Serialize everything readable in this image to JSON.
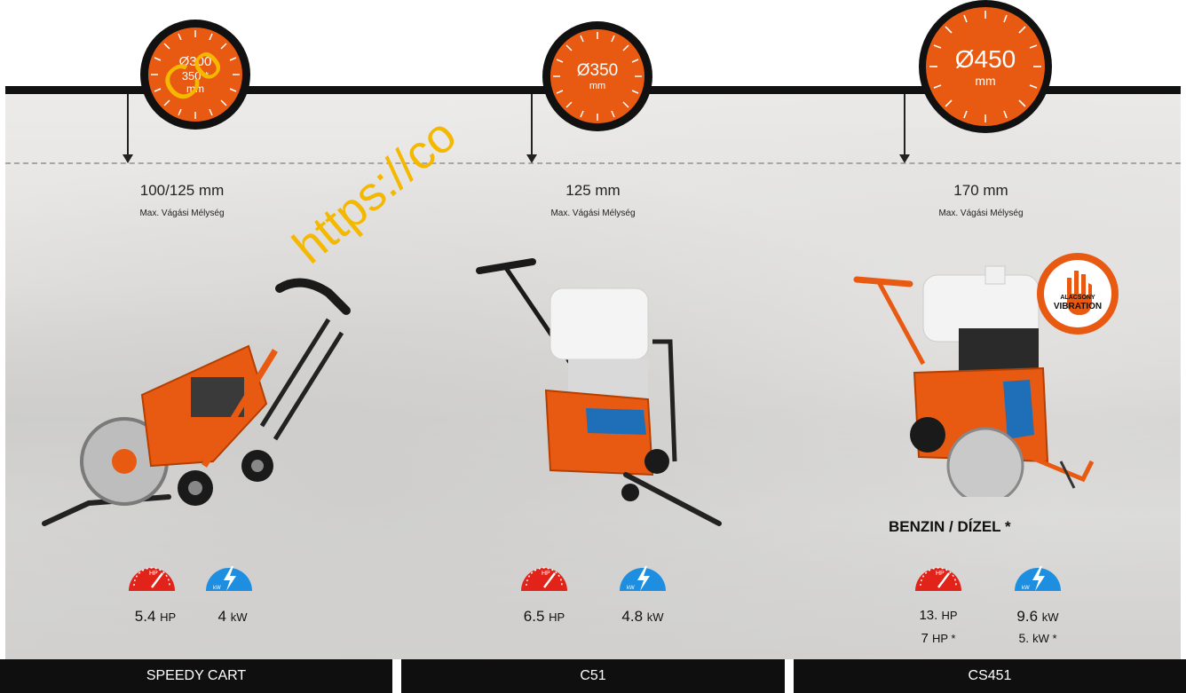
{
  "colors": {
    "accent": "#e85a12",
    "hp_gauge": "#e2231a",
    "kw_gauge": "#1e8fe0",
    "bar": "#111111"
  },
  "watermark": {
    "line1": "Co",
    "line2": "https://co"
  },
  "products": [
    {
      "disc": {
        "size": "Ø300",
        "line2": "350 *",
        "unit": "mm"
      },
      "depth": {
        "value": "100/125 mm",
        "label": "Max. Vágási Mélység"
      },
      "hp": {
        "value": "5.4",
        "unit": "HP",
        "icon": "hp-gauge-icon",
        "icon_label": "HP"
      },
      "kw": {
        "value": "4",
        "unit": "kW",
        "icon": "lightning-icon",
        "icon_label": "kW"
      },
      "name": "SPEEDY CART"
    },
    {
      "disc": {
        "size": "Ø350",
        "unit": "mm"
      },
      "depth": {
        "value": "125 mm",
        "label": "Max. Vágási Mélység"
      },
      "hp": {
        "value": "6.5",
        "unit": "HP",
        "icon": "hp-gauge-icon",
        "icon_label": "HP"
      },
      "kw": {
        "value": "4.8",
        "unit": "kW",
        "icon": "lightning-icon",
        "icon_label": "kW"
      },
      "name": "C51"
    },
    {
      "disc": {
        "size": "Ø450",
        "unit": "mm"
      },
      "depth": {
        "value": "170 mm",
        "label": "Max. Vágási Mélység"
      },
      "fuel": "BENZIN / DÍZEL *",
      "badge": {
        "top": "ALACSONY",
        "bottom": "VIBRATION"
      },
      "hp": {
        "value": "13.",
        "unit": "HP",
        "value2": "7",
        "unit2": "HP *",
        "icon": "hp-gauge-icon",
        "icon_label": "HP"
      },
      "kw": {
        "value": "9.6",
        "unit": "kW",
        "value2": "5.",
        "unit2": "kW *",
        "icon": "lightning-icon",
        "icon_label": "kW"
      },
      "name": "CS451"
    }
  ]
}
